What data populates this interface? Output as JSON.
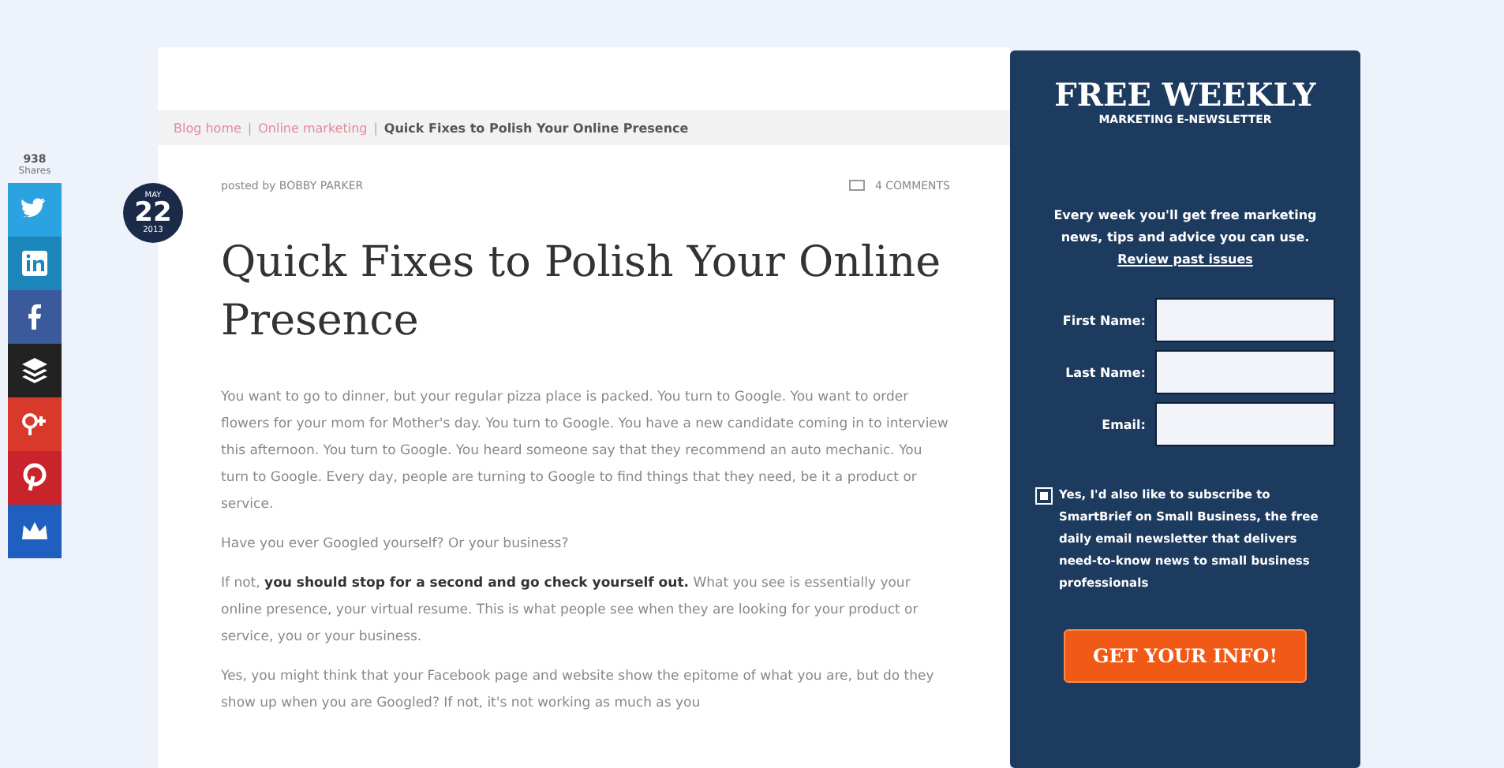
{
  "share_bar": {
    "count": "938",
    "count_label": "Shares",
    "buttons": [
      {
        "kind": "twitter",
        "color": "#2aa3e0"
      },
      {
        "kind": "linkedin",
        "color": "#1b86bc"
      },
      {
        "kind": "facebook",
        "color": "#3a5a9c"
      },
      {
        "kind": "buffer",
        "color": "#222222"
      },
      {
        "kind": "googleplus",
        "color": "#d8392b"
      },
      {
        "kind": "pinterest",
        "color": "#c9232c"
      },
      {
        "kind": "crown",
        "color": "#1f5fbf"
      }
    ]
  },
  "breadcrumb": {
    "separator": "|",
    "links": [
      "Blog home",
      "Online marketing"
    ],
    "current": "Quick Fixes to Polish Your Online Presence"
  },
  "post": {
    "date": {
      "month": "MAY",
      "day": "22",
      "year": "2013"
    },
    "byline": "posted by BOBBY PARKER",
    "comments": "4 COMMENTS",
    "title": "Quick Fixes to Polish Your Online Presence",
    "paragraphs": [
      "You want to go to dinner, but your regular pizza place is packed. You turn to Google. You want to order flowers for your mom for Mother's day. You turn to Google. You have a new candidate coming in to interview this afternoon. You turn to Google. You heard someone say that they recommend an auto mechanic. You turn to Google. Every day, people are turning to Google to find things that they need, be it a product or service.",
      "Have you ever Googled yourself? Or your business?",
      "If not, **you should stop for a second and go check yourself out.** What you see is essentially your online presence, your virtual resume. This is what people see when they are looking for your product or service, you or your business.",
      "Yes, you might think that your Facebook page and website show the epitome of what you are, but do they show up when you are Googled? If not, it's not working as much as you"
    ]
  },
  "newsletter": {
    "title": "FREE WEEKLY",
    "subtitle": "MARKETING E-NEWSLETTER",
    "intro": "Every week you'll get free marketing news, tips and advice you can use.",
    "link": "Review past issues",
    "fields": [
      {
        "label": "First Name:"
      },
      {
        "label": "Last Name:"
      },
      {
        "label": "Email:"
      }
    ],
    "optin": {
      "checked": true,
      "text": "Yes, I'd also like to subscribe to SmartBrief on Small Business, the free daily email newsletter that delivers need-to-know news to small business professionals"
    },
    "button": "GET YOUR INFO!"
  }
}
